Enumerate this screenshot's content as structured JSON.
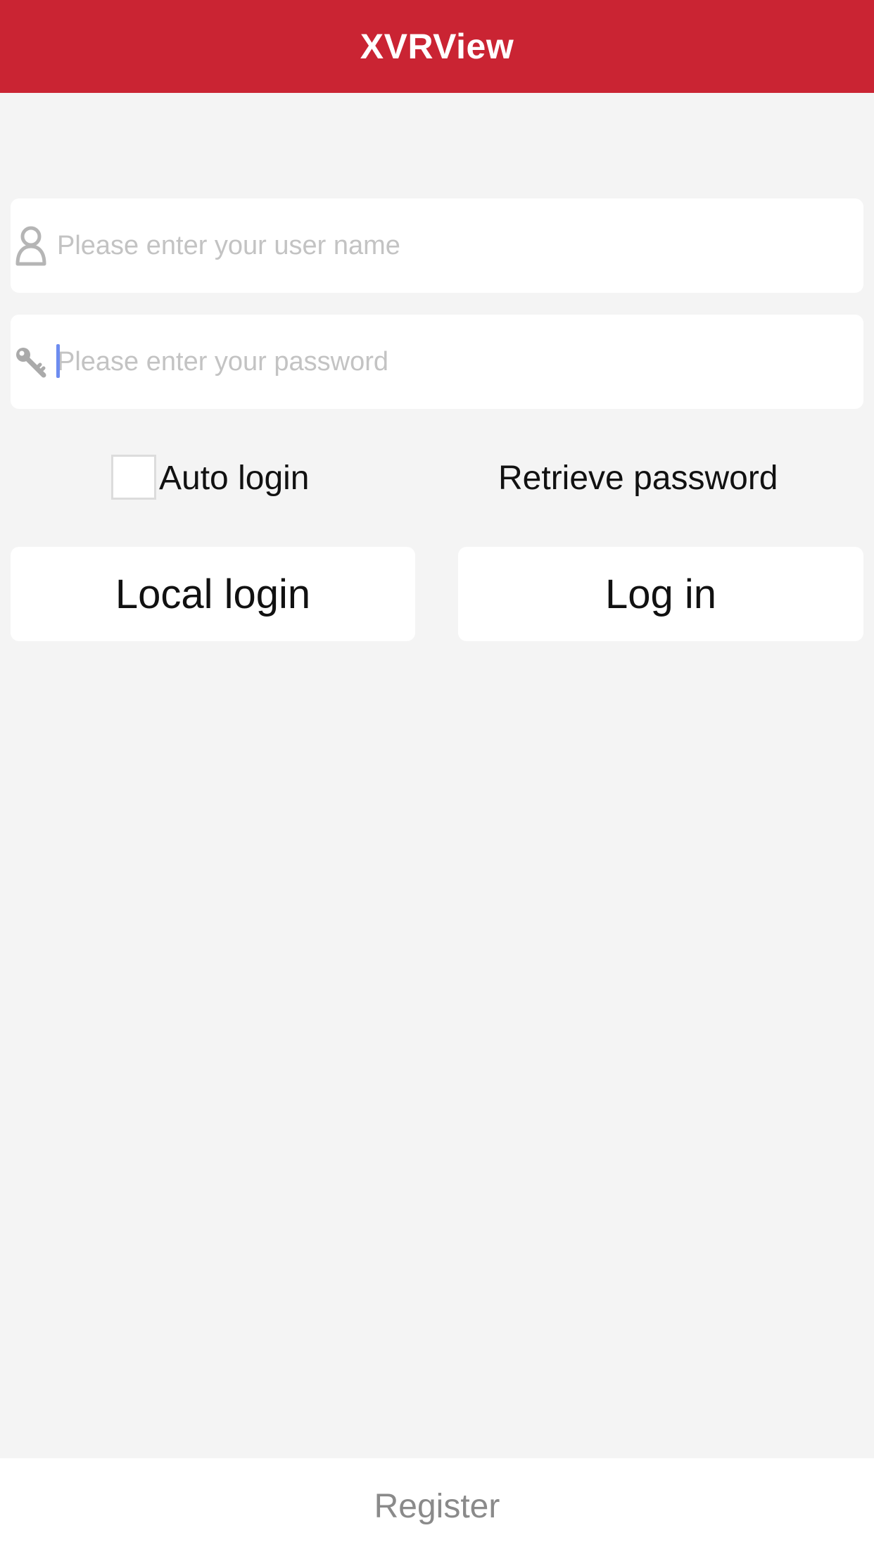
{
  "header": {
    "title": "XVRView",
    "background_color": "#ca2433"
  },
  "login_form": {
    "username": {
      "icon": "user-icon",
      "placeholder": "Please enter your user name",
      "value": ""
    },
    "password": {
      "icon": "key-icon",
      "placeholder": "Please enter your password",
      "value": ""
    },
    "auto_login": {
      "label": "Auto login",
      "checked": false
    },
    "retrieve_password_label": "Retrieve password",
    "local_login_label": "Local login",
    "login_label": "Log in"
  },
  "footer": {
    "register_label": "Register"
  },
  "colors": {
    "background": "#f4f4f4",
    "caret": "#6d8cf0",
    "placeholder": "#c3c3c3"
  }
}
